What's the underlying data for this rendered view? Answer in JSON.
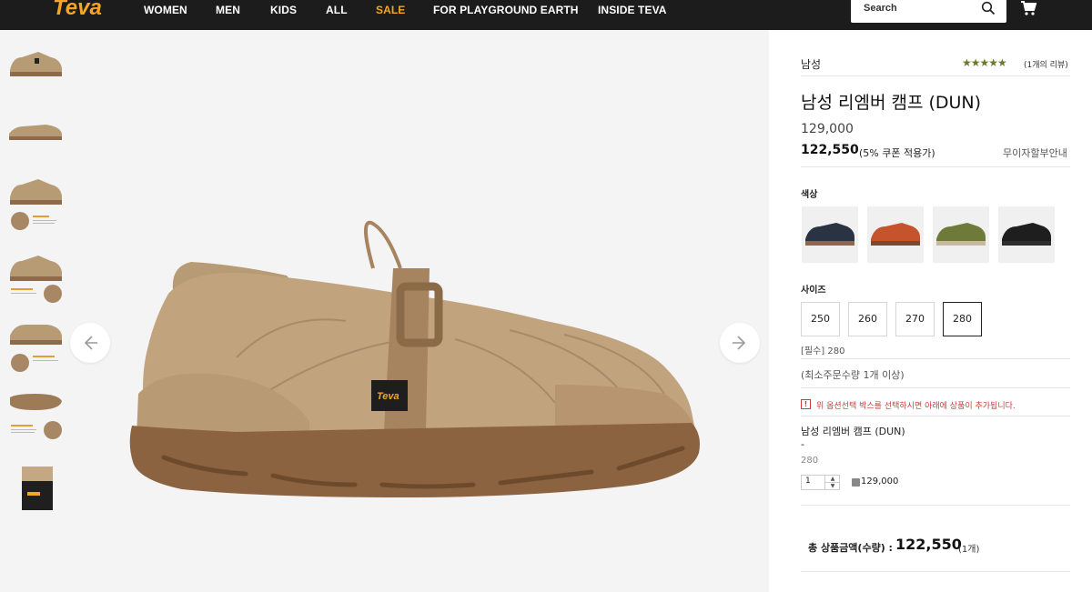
{
  "header": {
    "logo_text": "Teva",
    "nav": [
      "WOMEN",
      "MEN",
      "KIDS",
      "ALL",
      "SALE",
      "FOR PLAYGROUND EARTH",
      "INSIDE TEVA"
    ],
    "search_placeholder": "Search",
    "sale_color": "#f5a623"
  },
  "gallery": {
    "thumbnail_count": 7,
    "prev_icon": "arrow-left-icon",
    "next_icon": "arrow-right-icon",
    "shoe_color": "#b79b74"
  },
  "product": {
    "category": "남성",
    "rating_stars": 5,
    "review_count": "(1개의 리뷰)",
    "title": "남성 리엠버 캠프 (DUN)",
    "price_original": "129,000",
    "price_sale": "122,550",
    "coupon_note": "(5% 쿠폰 적용가)",
    "installment_link": "무이자할부안내",
    "color_label": "색상",
    "colors": [
      "navy",
      "orange",
      "olive",
      "black"
    ],
    "size_label": "사이즈",
    "sizes": [
      "250",
      "260",
      "270",
      "280"
    ],
    "selected_size": "280",
    "required_note": "[필수] 280",
    "min_order": "(최소주문수량 1개 이상)",
    "warning": "위 옵션선택 박스를 선택하시면 아래에 상품이 추가됩니다.",
    "selected_item": {
      "name": "남성 리엠버 캠프 (DUN)",
      "dash": "-",
      "size": "280",
      "qty": "1",
      "price": "129,000"
    },
    "total_label": "총 상품금액(수량) :",
    "total_value": "122,550",
    "total_count": "(1개)"
  }
}
